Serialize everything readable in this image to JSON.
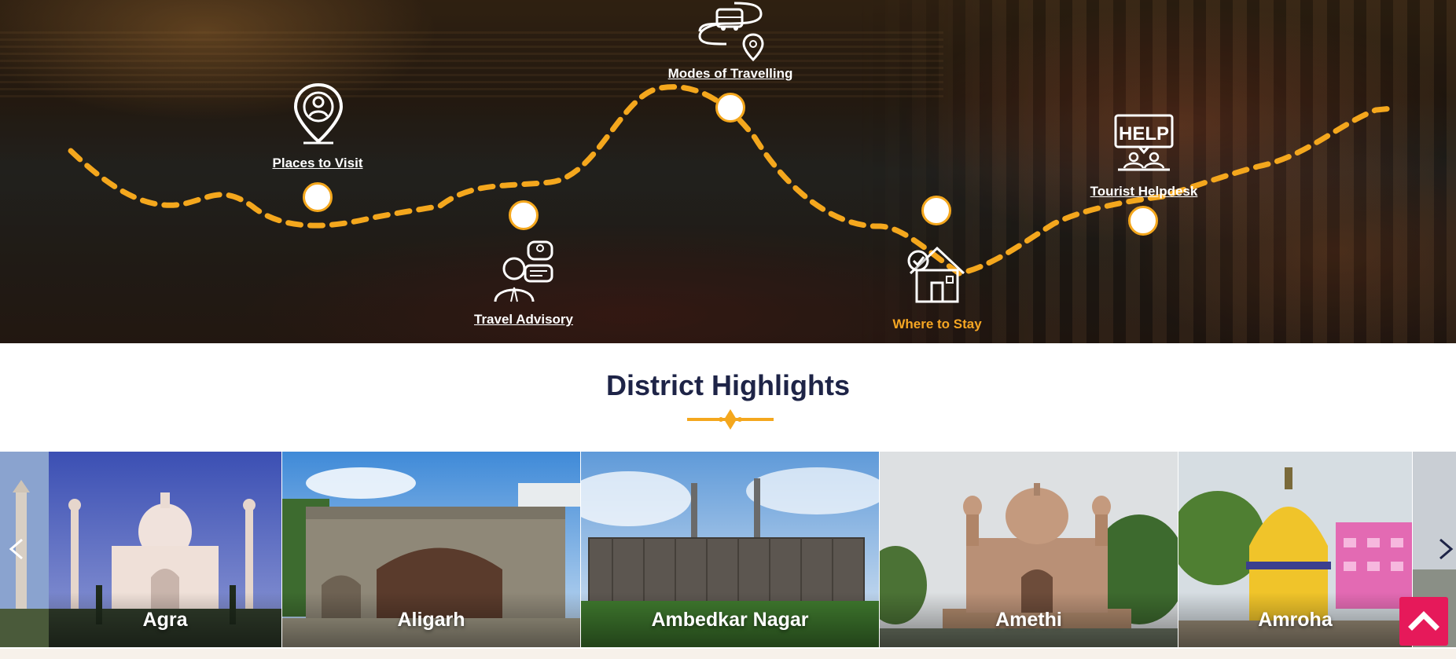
{
  "hero": {
    "stops": [
      {
        "label": "Places to Visit",
        "icon": "location-person-icon",
        "active": false
      },
      {
        "label": "Travel Advisory",
        "icon": "advisor-icon",
        "active": false
      },
      {
        "label": "Modes of Travelling",
        "icon": "route-bus-icon",
        "active": false
      },
      {
        "label": "Where to Stay",
        "icon": "home-check-icon",
        "active": true
      },
      {
        "label": "Tourist Helpdesk",
        "icon": "help-desk-icon",
        "active": false
      }
    ],
    "help_sign": "HELP",
    "colors": {
      "path": "#f4a71d",
      "active_label": "#f5a623"
    }
  },
  "highlights": {
    "title": "District Highlights",
    "title_color": "#1e2447",
    "divider_color": "#f4a71d",
    "prev_icon": "chevron-left-icon",
    "next_icon": "chevron-right-icon",
    "cards": [
      {
        "name": "Agra"
      },
      {
        "name": "Aligarh"
      },
      {
        "name": "Ambedkar Nagar"
      },
      {
        "name": "Amethi"
      },
      {
        "name": "Amroha"
      }
    ]
  },
  "scroll_top": {
    "icon": "chevron-up-icon",
    "color": "#e6195a"
  }
}
